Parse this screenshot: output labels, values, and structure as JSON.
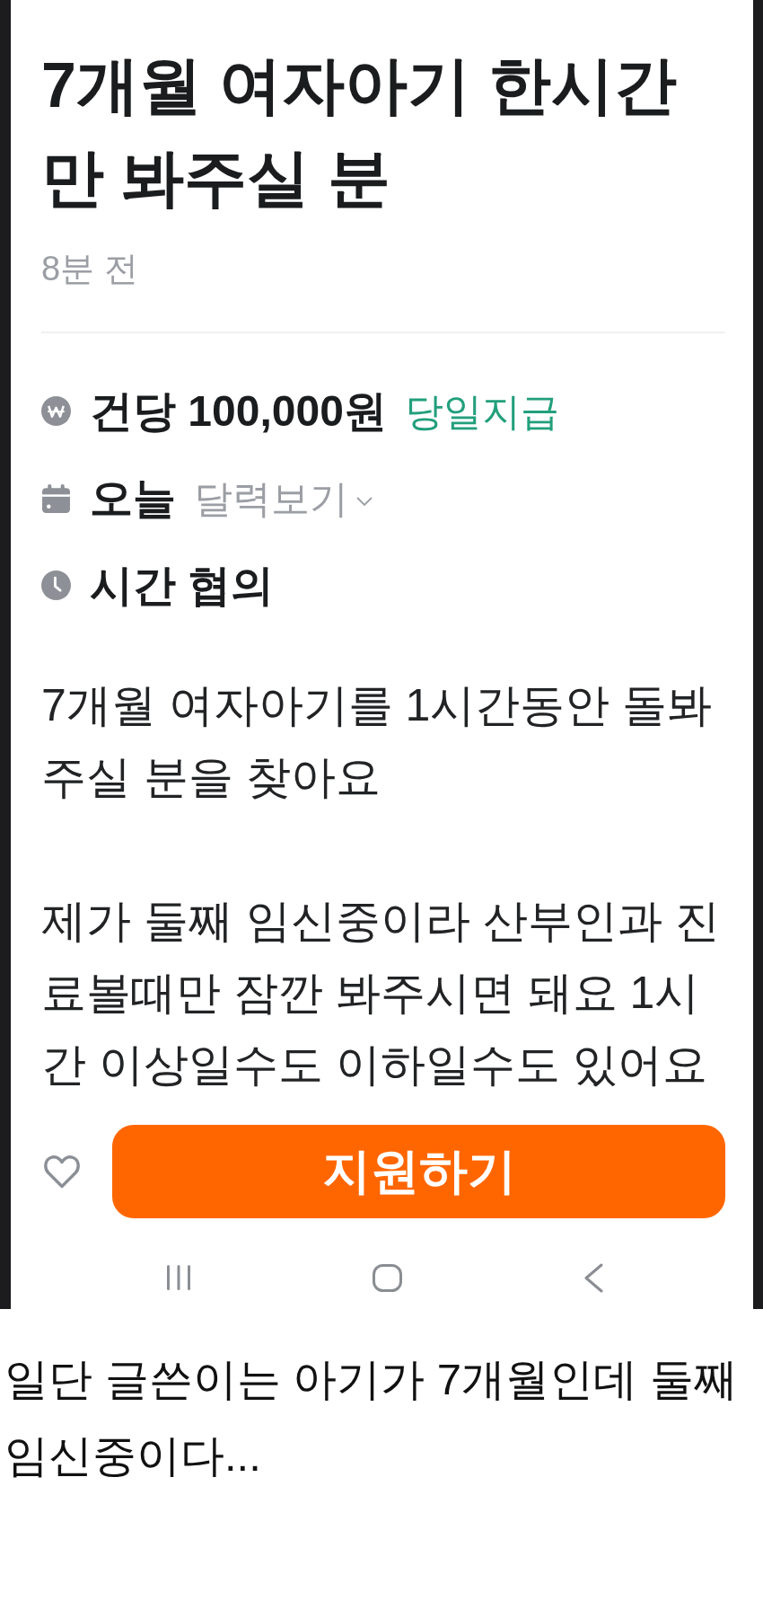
{
  "post": {
    "title": "7개월 여자아기 한시간만 봐주실 분",
    "time": "8분 전"
  },
  "details": [
    {
      "kind": "pay",
      "label": "건당 100,000원",
      "note": "당일지급"
    },
    {
      "kind": "date",
      "label": "오늘",
      "link": "달력보기"
    },
    {
      "kind": "time",
      "label": "시간 협의"
    }
  ],
  "description": [
    "7개월 여자아기를 1시간동안 돌봐주실 분을 찾아요",
    "제가 둘째 임신중이라 산부인과 진료볼때만 잠깐 봐주시면 돼요 1시간 이상일수도 이하일수도 있어요"
  ],
  "apply_button": "지원하기",
  "caption": "일단 글쓴이는 아기가 7개월인데 둘째 임신중이다..."
}
